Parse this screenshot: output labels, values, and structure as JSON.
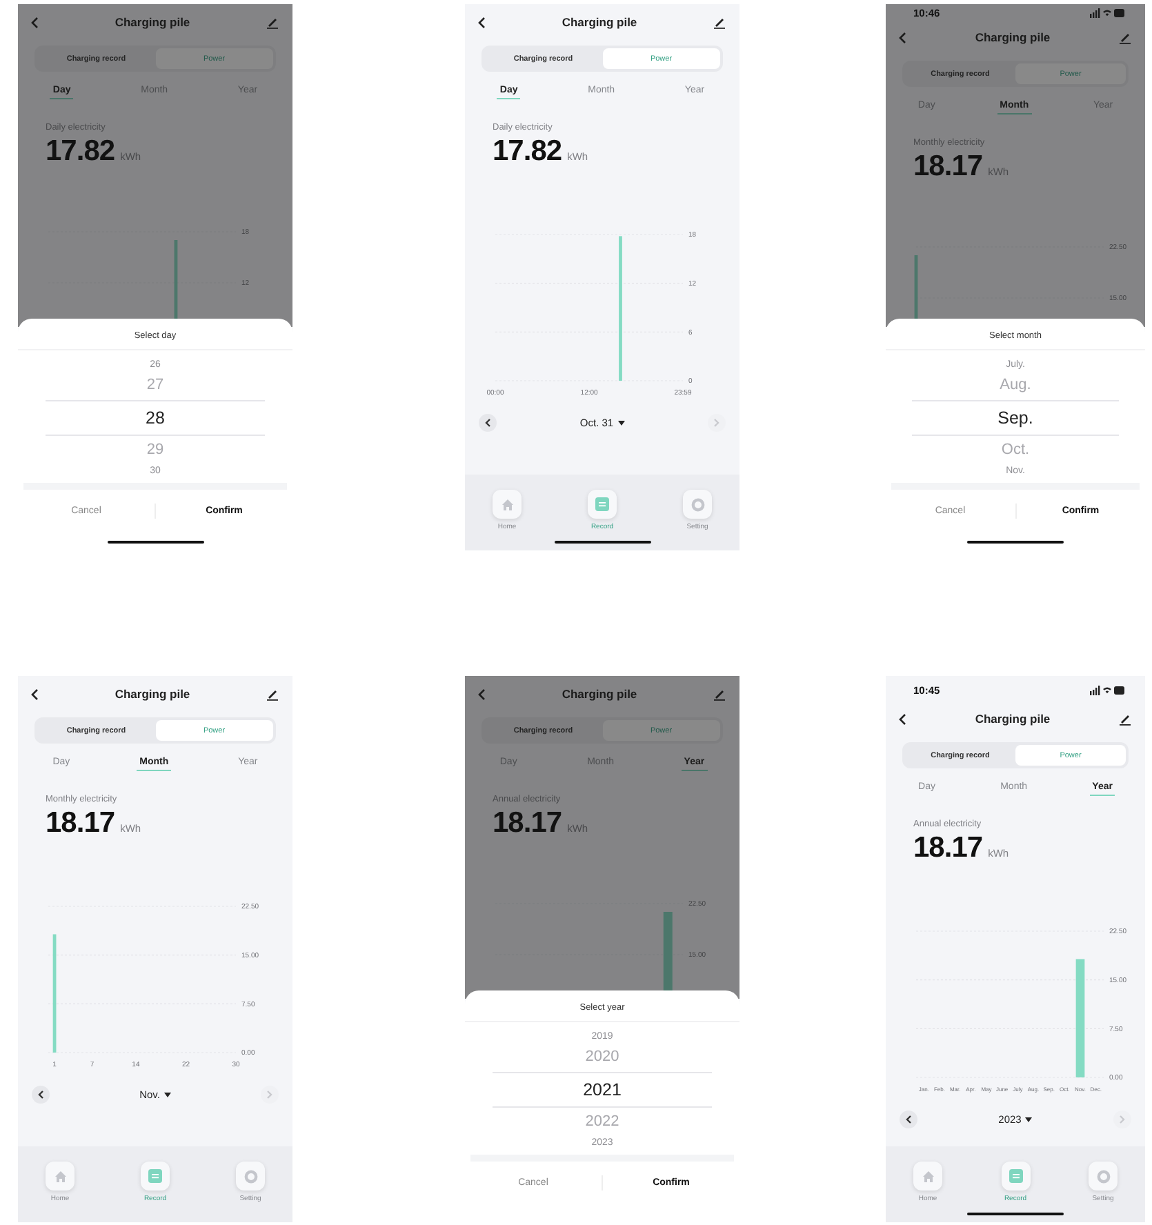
{
  "screens": [
    {
      "title": "Charging pile",
      "segments": [
        {
          "label": "Charging record",
          "selected": false
        },
        {
          "label": "Power",
          "selected": true
        }
      ],
      "periods": [
        {
          "label": "Day",
          "selected": true
        },
        {
          "label": "Month",
          "selected": false
        },
        {
          "label": "Year",
          "selected": false
        }
      ],
      "metric_label": "Daily electricity",
      "metric_value": "17.82",
      "metric_unit": "kWh",
      "chart_fragment": {
        "ticks": [
          "18",
          "12"
        ]
      },
      "picker": {
        "title": "Select day",
        "items": [
          {
            "text": "26",
            "selected": false
          },
          {
            "text": "27",
            "selected": false
          },
          {
            "text": "28",
            "selected": true
          },
          {
            "text": "29",
            "selected": false
          },
          {
            "text": "30",
            "selected": false
          }
        ],
        "cancel": "Cancel",
        "confirm": "Confirm"
      },
      "home_indicator": true
    },
    {
      "title": "Charging pile",
      "segments": [
        {
          "label": "Charging record",
          "selected": false
        },
        {
          "label": "Power",
          "selected": true
        }
      ],
      "periods": [
        {
          "label": "Day",
          "selected": true
        },
        {
          "label": "Month",
          "selected": false
        },
        {
          "label": "Year",
          "selected": false
        }
      ],
      "metric_label": "Daily electricity",
      "metric_value": "17.82",
      "metric_unit": "kWh",
      "chart_data": {
        "type": "bar",
        "x": [
          16
        ],
        "values": [
          17.8
        ],
        "xlim": [
          0,
          23.98
        ],
        "xticks": [
          {
            "value": 0,
            "label": "00:00"
          },
          {
            "value": 12,
            "label": "12:00"
          },
          {
            "value": 23.98,
            "label": "23:59"
          }
        ],
        "ylim": [
          0,
          18
        ],
        "yticks": [
          0,
          6,
          12,
          18
        ]
      },
      "date_nav": {
        "label": "Oct. 31",
        "prev_disabled": false,
        "next_disabled": true
      },
      "tab_bar": [
        {
          "kind": "home",
          "label": "Home",
          "selected": false
        },
        {
          "kind": "record",
          "label": "Record",
          "selected": true
        },
        {
          "kind": "setting",
          "label": "Setting",
          "selected": false
        }
      ],
      "home_indicator": true
    },
    {
      "status_bar": {
        "time": "10:46"
      },
      "title": "Charging pile",
      "segments": [
        {
          "label": "Charging record",
          "selected": false
        },
        {
          "label": "Power",
          "selected": true
        }
      ],
      "periods": [
        {
          "label": "Day",
          "selected": false
        },
        {
          "label": "Month",
          "selected": true
        },
        {
          "label": "Year",
          "selected": false
        }
      ],
      "metric_label": "Monthly electricity",
      "metric_value": "18.17",
      "metric_unit": "kWh",
      "chart_fragment": {
        "ticks": [
          "22.50",
          "15.00"
        ]
      },
      "picker": {
        "title": "Select month",
        "items": [
          {
            "text": "July.",
            "selected": false
          },
          {
            "text": "Aug.",
            "selected": false
          },
          {
            "text": "Sep.",
            "selected": true
          },
          {
            "text": "Oct.",
            "selected": false
          },
          {
            "text": "Nov.",
            "selected": false
          }
        ],
        "cancel": "Cancel",
        "confirm": "Confirm"
      },
      "home_indicator": true
    },
    {
      "title": "Charging pile",
      "segments": [
        {
          "label": "Charging record",
          "selected": false
        },
        {
          "label": "Power",
          "selected": true
        }
      ],
      "periods": [
        {
          "label": "Day",
          "selected": false
        },
        {
          "label": "Month",
          "selected": true
        },
        {
          "label": "Year",
          "selected": false
        }
      ],
      "metric_label": "Monthly electricity",
      "metric_value": "18.17",
      "metric_unit": "kWh",
      "chart_data": {
        "type": "bar",
        "x": [
          1
        ],
        "values": [
          18.2
        ],
        "xlim": [
          0,
          30
        ],
        "xticks": [
          1,
          7,
          14,
          22,
          30
        ],
        "ylim": [
          0,
          22.5
        ],
        "yticks": [
          {
            "value": 0,
            "label": "0.00"
          },
          {
            "value": 7.5,
            "label": "7.50"
          },
          {
            "value": 15,
            "label": "15.00"
          },
          {
            "value": 22.5,
            "label": "22.50"
          }
        ]
      },
      "date_nav": {
        "label": "Nov.",
        "prev_disabled": false,
        "next_disabled": true
      },
      "tab_bar": [
        {
          "kind": "home",
          "label": "Home",
          "selected": false
        },
        {
          "kind": "record",
          "label": "Record",
          "selected": true
        },
        {
          "kind": "setting",
          "label": "Setting",
          "selected": false
        }
      ],
      "home_indicator": false
    },
    {
      "title": "Charging pile",
      "segments": [
        {
          "label": "Charging record",
          "selected": false
        },
        {
          "label": "Power",
          "selected": true
        }
      ],
      "periods": [
        {
          "label": "Day",
          "selected": false
        },
        {
          "label": "Month",
          "selected": false
        },
        {
          "label": "Year",
          "selected": true
        }
      ],
      "metric_label": "Annual electricity",
      "metric_value": "18.17",
      "metric_unit": "kWh",
      "chart_fragment": {
        "ticks": [
          "22.50",
          "15.00"
        ]
      },
      "picker": {
        "title": "Select year",
        "items": [
          {
            "text": "2019",
            "selected": false
          },
          {
            "text": "2020",
            "selected": false
          },
          {
            "text": "2021",
            "selected": true
          },
          {
            "text": "2022",
            "selected": false
          },
          {
            "text": "2023",
            "selected": false
          }
        ],
        "cancel": "Cancel",
        "confirm": "Confirm"
      },
      "home_indicator": false
    },
    {
      "status_bar": {
        "time": "10:45"
      },
      "title": "Charging pile",
      "segments": [
        {
          "label": "Charging record",
          "selected": false
        },
        {
          "label": "Power",
          "selected": true
        }
      ],
      "periods": [
        {
          "label": "Day",
          "selected": false
        },
        {
          "label": "Month",
          "selected": false
        },
        {
          "label": "Year",
          "selected": true
        }
      ],
      "metric_label": "Annual electricity",
      "metric_value": "18.17",
      "metric_unit": "kWh",
      "chart_data": {
        "type": "bar",
        "categories": [
          "Jan.",
          "Feb.",
          "Mar.",
          "Apr.",
          "May",
          "June",
          "July",
          "Aug.",
          "Sep.",
          "Oct.",
          "Nov.",
          "Dec."
        ],
        "values": [
          null,
          null,
          null,
          null,
          null,
          null,
          null,
          null,
          null,
          null,
          18.2,
          null
        ],
        "ylim": [
          0,
          22.5
        ],
        "yticks": [
          {
            "value": 0,
            "label": "0.00"
          },
          {
            "value": 7.5,
            "label": "7.50"
          },
          {
            "value": 15,
            "label": "15.00"
          },
          {
            "value": 22.5,
            "label": "22.50"
          }
        ]
      },
      "date_nav": {
        "label": "2023",
        "prev_disabled": false,
        "next_disabled": true
      },
      "tab_bar": [
        {
          "kind": "home",
          "label": "Home",
          "selected": false
        },
        {
          "kind": "record",
          "label": "Record",
          "selected": true
        },
        {
          "kind": "setting",
          "label": "Setting",
          "selected": false
        }
      ],
      "home_indicator": true
    }
  ]
}
